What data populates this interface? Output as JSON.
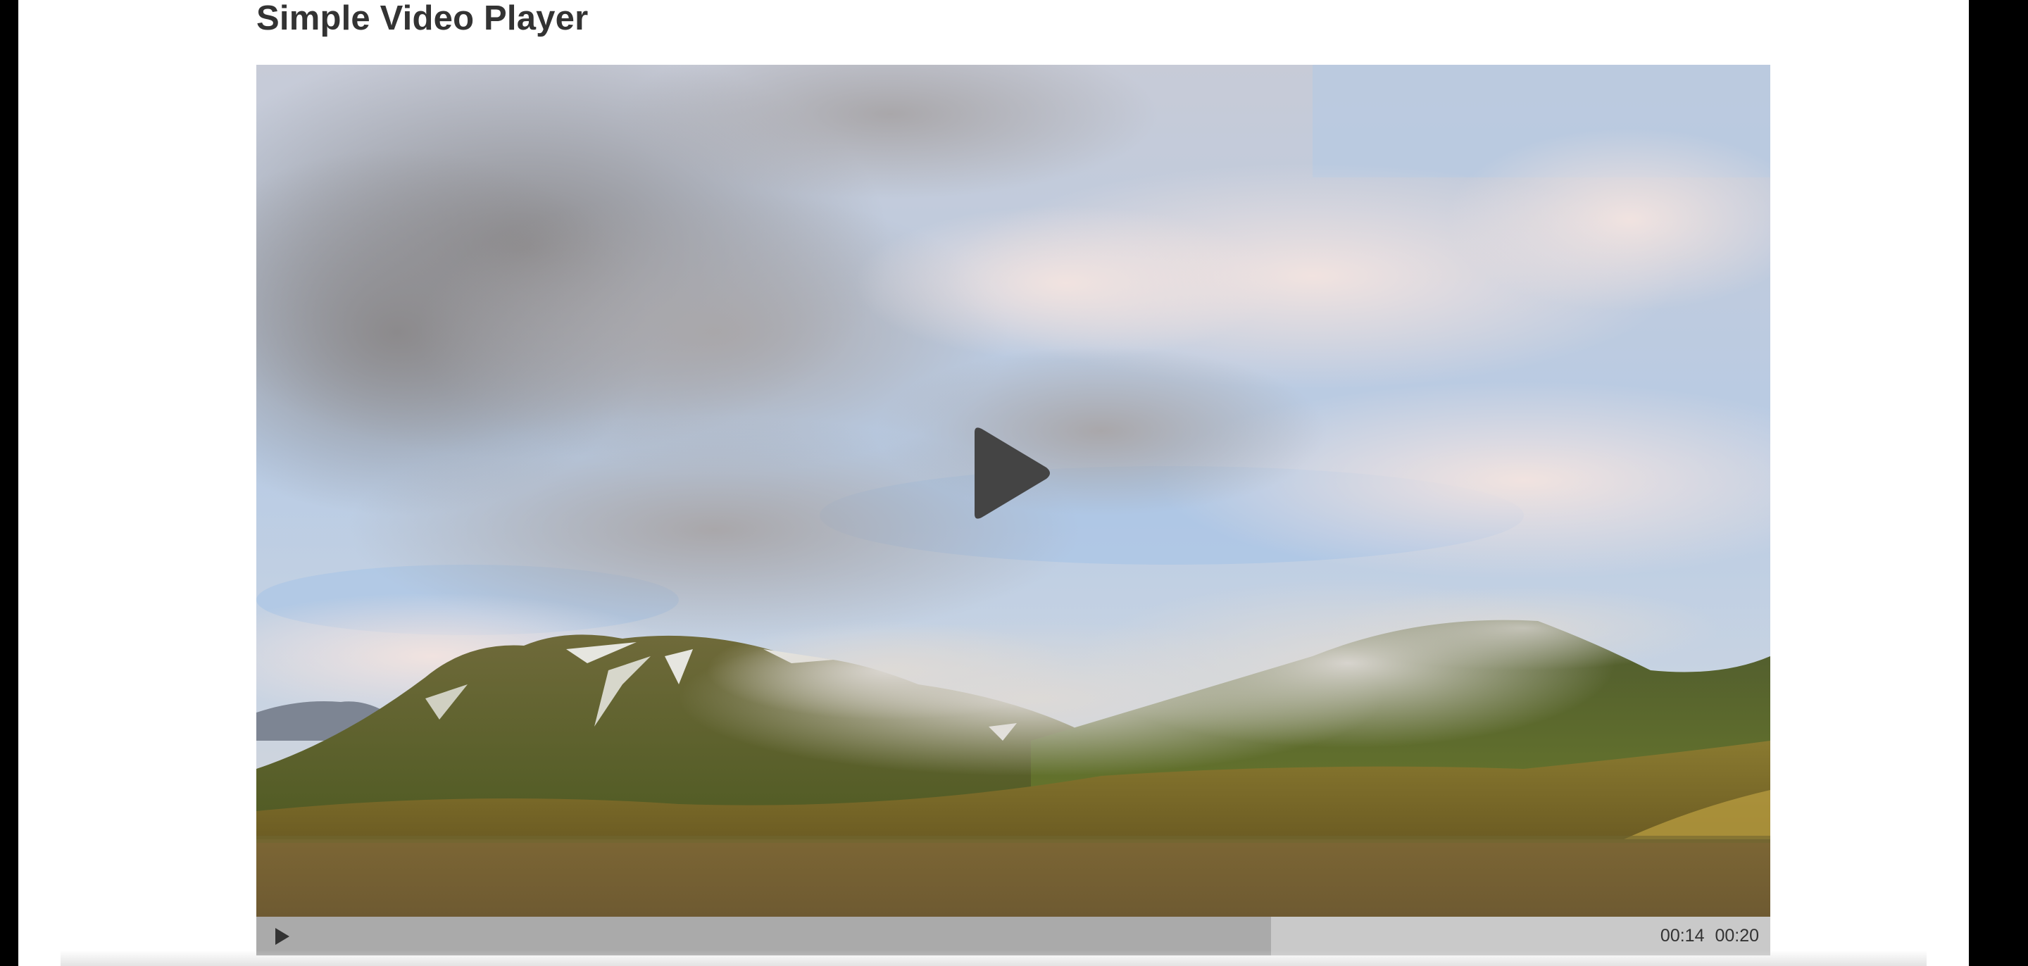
{
  "page": {
    "title": "Simple Video Player"
  },
  "player": {
    "big_play_icon": "play-icon",
    "small_play_icon": "play-icon",
    "current_time": "00:14",
    "duration": "00:20",
    "progress_fraction": 0.67,
    "colors": {
      "controls_bar": "#c9c9c9",
      "progress_played": "#aaaaaa",
      "play_icon": "#444444"
    }
  }
}
